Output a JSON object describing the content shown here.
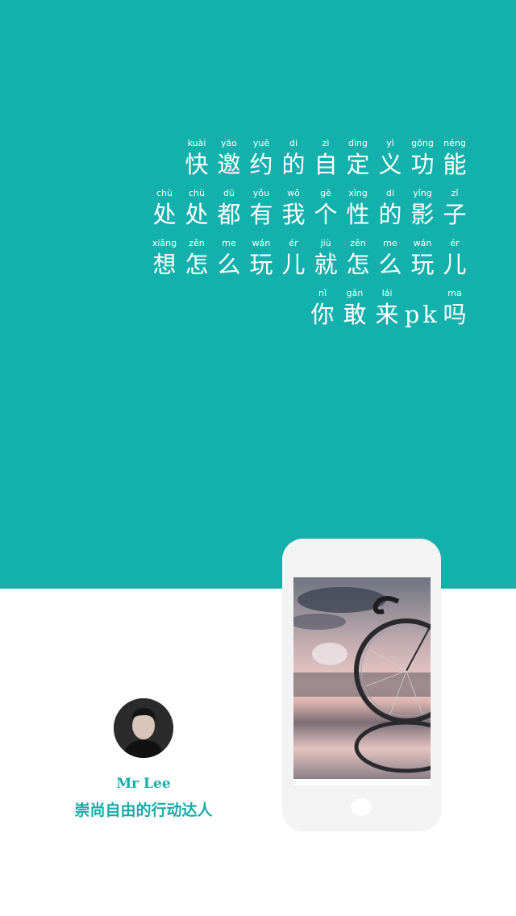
{
  "poem": {
    "lines": [
      [
        {
          "py": "kuài",
          "hz": "快"
        },
        {
          "py": "yāo",
          "hz": "邀"
        },
        {
          "py": "yuē",
          "hz": "约"
        },
        {
          "py": "di",
          "hz": "的"
        },
        {
          "py": "zì",
          "hz": "自"
        },
        {
          "py": "dìng",
          "hz": "定"
        },
        {
          "py": "yì",
          "hz": "义"
        },
        {
          "py": "gōng",
          "hz": "功"
        },
        {
          "py": "néng",
          "hz": "能"
        }
      ],
      [
        {
          "py": "chù",
          "hz": "处"
        },
        {
          "py": "chù",
          "hz": "处"
        },
        {
          "py": "dū",
          "hz": "都"
        },
        {
          "py": "yǒu",
          "hz": "有"
        },
        {
          "py": "wǒ",
          "hz": "我"
        },
        {
          "py": "gè",
          "hz": "个"
        },
        {
          "py": "xìng",
          "hz": "性"
        },
        {
          "py": "di",
          "hz": "的"
        },
        {
          "py": "yǐng",
          "hz": "影"
        },
        {
          "py": "zǐ",
          "hz": "子"
        }
      ],
      [
        {
          "py": "xiǎng",
          "hz": "想"
        },
        {
          "py": "zěn",
          "hz": "怎"
        },
        {
          "py": "me",
          "hz": "么"
        },
        {
          "py": "wán",
          "hz": "玩"
        },
        {
          "py": "ér",
          "hz": "儿"
        },
        {
          "py": "jiù",
          "hz": "就"
        },
        {
          "py": "zěn",
          "hz": "怎"
        },
        {
          "py": "me",
          "hz": "么"
        },
        {
          "py": "wán",
          "hz": "玩"
        },
        {
          "py": "ér",
          "hz": "儿"
        }
      ],
      [
        {
          "py": "nǐ",
          "hz": "你"
        },
        {
          "py": "gǎn",
          "hz": "敢"
        },
        {
          "py": "lái",
          "hz": "来"
        },
        {
          "py": "",
          "hz": "p",
          "narrow": true
        },
        {
          "py": "",
          "hz": "k",
          "narrow": true
        },
        {
          "py": "ma",
          "hz": "吗"
        }
      ]
    ]
  },
  "phone": {
    "screen_image": "photo-bicycle-wheel-sunset-reflection"
  },
  "profile": {
    "avatar": "avatar-man-portrait",
    "name": "Mr Lee",
    "tagline": "崇尚自由的行动达人"
  },
  "colors": {
    "teal": "#14b1ac",
    "accent_text": "#16aca7",
    "white": "#ffffff"
  }
}
